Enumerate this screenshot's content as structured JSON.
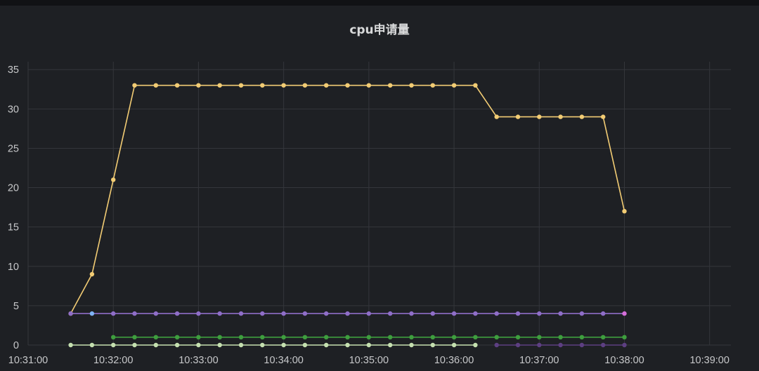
{
  "panel": {
    "title": "cpu申请量"
  },
  "chart_data": {
    "type": "line",
    "title": "cpu申请量",
    "xlabel": "",
    "ylabel": "",
    "x_ticks": [
      "10:31:00",
      "10:32:00",
      "10:33:00",
      "10:34:00",
      "10:35:00",
      "10:36:00",
      "10:37:00",
      "10:38:00",
      "10:39:00"
    ],
    "y_ticks": [
      0,
      5,
      10,
      15,
      20,
      25,
      30,
      35
    ],
    "xlim": [
      "10:31:00",
      "10:39:15"
    ],
    "ylim": [
      0,
      36
    ],
    "grid": true,
    "legend": "none",
    "x": [
      "10:31:30",
      "10:31:45",
      "10:32:00",
      "10:32:15",
      "10:32:30",
      "10:32:45",
      "10:33:00",
      "10:33:15",
      "10:33:30",
      "10:33:45",
      "10:34:00",
      "10:34:15",
      "10:34:30",
      "10:34:45",
      "10:35:00",
      "10:35:15",
      "10:35:30",
      "10:35:45",
      "10:36:00",
      "10:36:15",
      "10:36:30",
      "10:36:45",
      "10:37:00",
      "10:37:15",
      "10:37:30",
      "10:37:45",
      "10:38:00"
    ],
    "series": [
      {
        "color": "#f2cc74",
        "values": [
          4,
          9,
          21,
          33,
          33,
          33,
          33,
          33,
          33,
          33,
          33,
          33,
          33,
          33,
          33,
          33,
          33,
          33,
          33,
          33,
          29,
          29,
          29,
          29,
          29,
          29,
          17
        ]
      },
      {
        "color": "#8f6ec8",
        "values": [
          4,
          4,
          4,
          4,
          4,
          4,
          4,
          4,
          4,
          4,
          4,
          4,
          4,
          4,
          4,
          4,
          4,
          4,
          4,
          4,
          4,
          4,
          4,
          4,
          4,
          4,
          4
        ]
      },
      {
        "color": "#3e9e3e",
        "values": [
          null,
          null,
          1,
          1,
          1,
          1,
          1,
          1,
          1,
          1,
          1,
          1,
          1,
          1,
          1,
          1,
          1,
          1,
          1,
          1,
          1,
          1,
          1,
          1,
          1,
          1,
          1
        ]
      },
      {
        "color": "#c5e0b0",
        "values": [
          0,
          0,
          0,
          0,
          0,
          0,
          0,
          0,
          0,
          0,
          0,
          0,
          0,
          0,
          0,
          0,
          0,
          0,
          0,
          0,
          null,
          null,
          null,
          null,
          null,
          null,
          null
        ]
      },
      {
        "color": "#5d3f82",
        "values": [
          null,
          null,
          null,
          null,
          null,
          null,
          null,
          null,
          null,
          null,
          null,
          null,
          null,
          null,
          null,
          null,
          null,
          null,
          null,
          null,
          0,
          0,
          0,
          0,
          0,
          0,
          0
        ]
      }
    ],
    "point_overrides": [
      {
        "series": 1,
        "index": 1,
        "color": "#7eb3f5"
      },
      {
        "series": 1,
        "index": 26,
        "color": "#d46ed9"
      }
    ]
  }
}
